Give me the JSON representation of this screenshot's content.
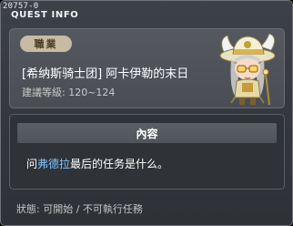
{
  "quest_id": "20757-0",
  "window_title": "QUEST INFO",
  "job_tag": "職業",
  "quest_name": "[希纳斯骑士团] 阿卡伊勒的末日",
  "quest_level": "建議等級: 120~124",
  "content_header": "內容",
  "description": {
    "prefix": "问",
    "highlight": "弗德拉",
    "suffix": "最后的任务是什么。"
  },
  "status": "狀態: 可開始 / 不可執行任務",
  "npc_icon": "npc-portrait-icon",
  "colors": {
    "highlight": "#7ec3ff",
    "job_tag_bg": "#c8bba3",
    "panel_bg": "#4a4e54"
  }
}
